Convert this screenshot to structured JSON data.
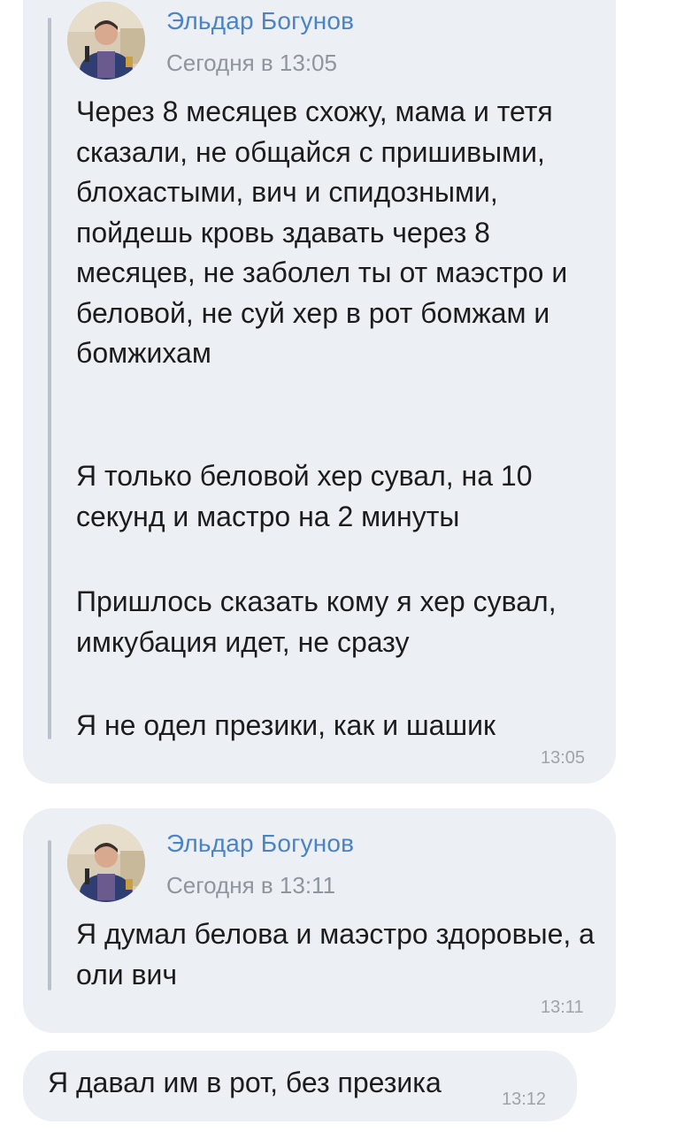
{
  "messages": [
    {
      "author": "Эльдар Богунов",
      "date": "Сегодня в 13:05",
      "paragraphs": [
        "Через 8 месяцев схожу, мама и тетя сказали, не общайся с пришивыми, блохастыми, вич и спидозными, пойдешь кровь здавать через 8 месяцев, не заболел ты от маэстро и беловой, не суй хер в рот бомжам и бомжихам",
        "Я только беловой хер сувал, на 10 секунд и мастро на 2 минуты",
        "Пришлось сказать кому я хер сувал, имкубация идет, не сразу",
        "Я не одел презики, как и шашик"
      ],
      "time": "13:05"
    },
    {
      "author": "Эльдар Богунов",
      "date": "Сегодня в 13:11",
      "text": "Я думал белова и маэстро здоровые, а оли вич",
      "time": "13:11"
    },
    {
      "text": "Я давал им в рот, без презика",
      "time": "13:12"
    }
  ],
  "colors": {
    "bubble": "#eceff3",
    "author": "#4a84c4",
    "quote_bar": "#b9c2cc",
    "meta": "#8f959c"
  },
  "icons": [
    "avatar-photo"
  ]
}
